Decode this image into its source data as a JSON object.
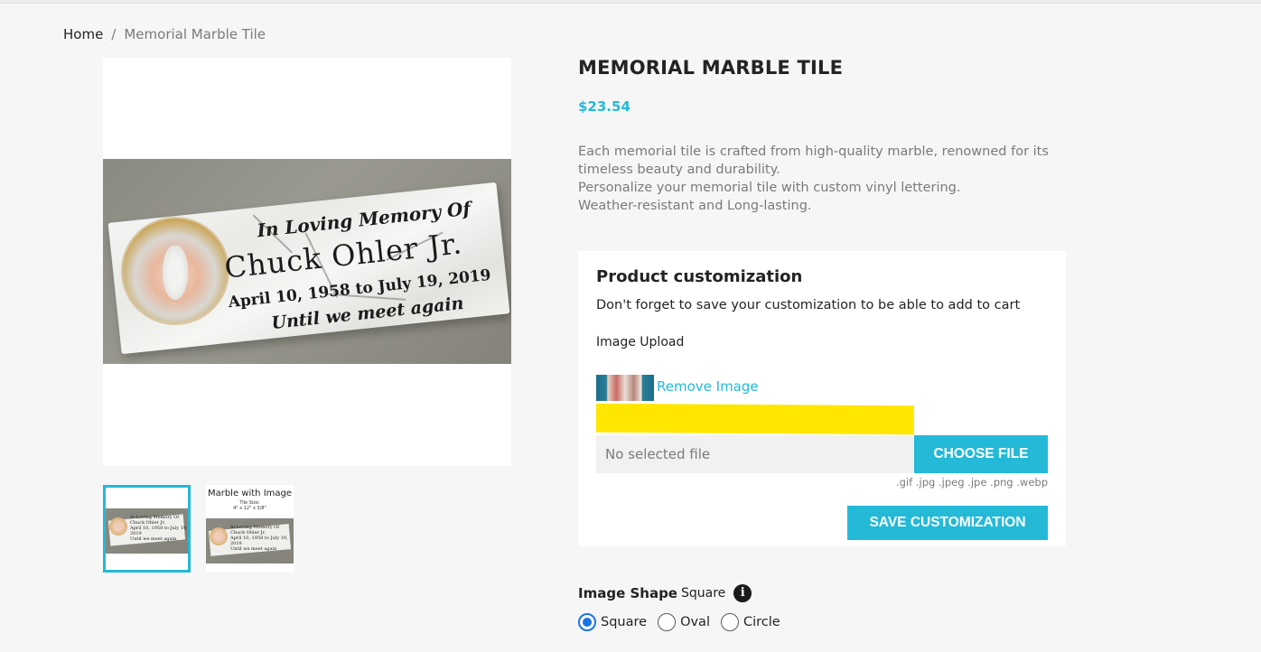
{
  "breadcrumb": {
    "home": "Home",
    "separator": "/",
    "current": "Memorial Marble Tile"
  },
  "gallery": {
    "main_image_text": {
      "line1": "In Loving Memory Of",
      "line2": "Chuck Ohler Jr.",
      "line3": "April 10, 1958 to July 19, 2019",
      "line4": "Until we meet again"
    },
    "thumbnails": [
      {
        "selected": true
      },
      {
        "selected": false,
        "title": "Marble with Image",
        "subtitle_1": "Tile Size:",
        "subtitle_2": "4\" x 12\" x 3/8\""
      }
    ]
  },
  "product": {
    "title": "MEMORIAL MARBLE TILE",
    "price": "$23.54",
    "description": [
      "Each memorial tile is crafted from high-quality marble, renowned for its",
      "timeless beauty and durability.",
      "Personalize your memorial tile with custom vinyl lettering.",
      "Weather-resistant and Long-lasting."
    ]
  },
  "customization": {
    "title": "Product customization",
    "note": "Don't forget to save your customization to be able to add to cart",
    "upload_label": "Image Upload",
    "remove_label": "Remove Image",
    "file_placeholder": "No selected file",
    "choose_label": "CHOOSE FILE",
    "file_types": ".gif .jpg .jpeg .jpe .png .webp",
    "save_label": "SAVE CUSTOMIZATION"
  },
  "image_shape": {
    "label": "Image Shape",
    "selected": "Square",
    "options": [
      "Square",
      "Oval",
      "Circle"
    ]
  },
  "colors": {
    "accent": "#24b9d7",
    "highlight": "#ffe600",
    "radio_selected": "#1a73e8"
  }
}
